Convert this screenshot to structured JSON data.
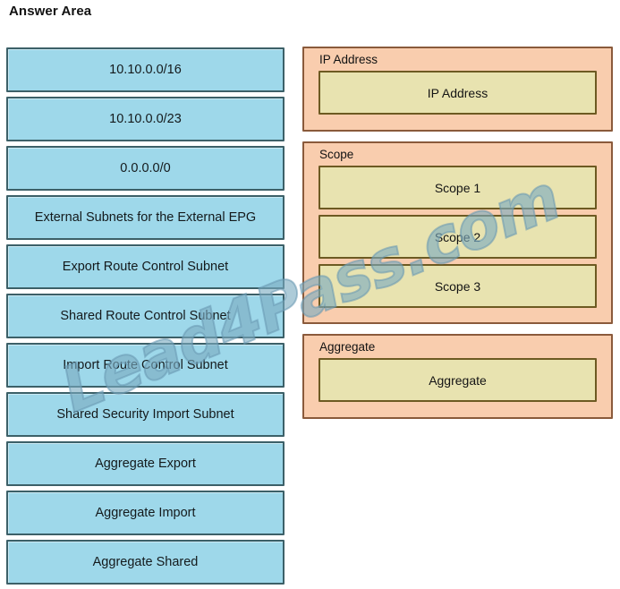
{
  "page": {
    "title": "Answer Area",
    "watermark": "Lead4Pass.com",
    "colors": {
      "source_tile_fill": "#9ed8ea",
      "source_tile_border": "#3c6068",
      "group_fill": "#f9cdae",
      "group_border": "#8a5a3b",
      "slot_fill": "#e8e3b0",
      "slot_border": "#6d5a22",
      "background": "#ffffff",
      "watermark": "#7aabc0"
    }
  },
  "source_list": {
    "name": "draggable-options",
    "items": [
      {
        "label": "10.10.0.0/16"
      },
      {
        "label": "10.10.0.0/23"
      },
      {
        "label": "0.0.0.0/0"
      },
      {
        "label": "External Subnets for the External EPG"
      },
      {
        "label": "Export Route Control Subnet"
      },
      {
        "label": "Shared Route Control Subnet"
      },
      {
        "label": "Import Route Control Subnet"
      },
      {
        "label": "Shared Security Import Subnet"
      },
      {
        "label": "Aggregate Export"
      },
      {
        "label": "Aggregate Import"
      },
      {
        "label": "Aggregate Shared"
      }
    ]
  },
  "target_groups": [
    {
      "title": "IP Address",
      "slots": [
        {
          "label": "IP Address"
        }
      ]
    },
    {
      "title": "Scope",
      "slots": [
        {
          "label": "Scope 1"
        },
        {
          "label": "Scope 2"
        },
        {
          "label": "Scope 3"
        }
      ]
    },
    {
      "title": "Aggregate",
      "slots": [
        {
          "label": "Aggregate"
        }
      ]
    }
  ]
}
